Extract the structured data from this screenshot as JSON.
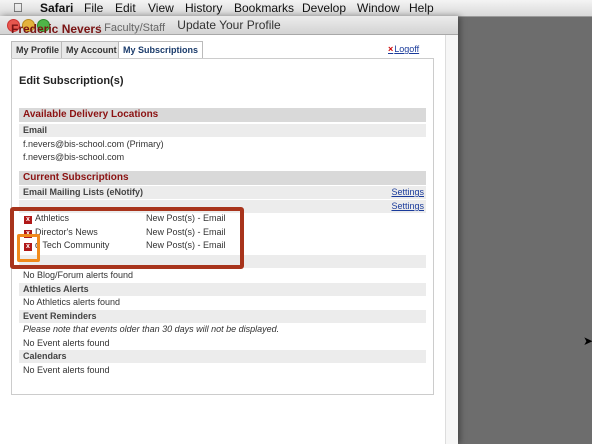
{
  "menubar": {
    "app": "Safari",
    "items": [
      "File",
      "Edit",
      "View",
      "History",
      "Bookmarks",
      "Develop",
      "Window",
      "Help"
    ]
  },
  "window": {
    "title": "Update Your Profile"
  },
  "profile": {
    "name": "Frederic Nevers",
    "role": ": Faculty/Staff"
  },
  "tabs": [
    "My Profile",
    "My Account",
    "My Subscriptions"
  ],
  "active_tab": "My Subscriptions",
  "logout": {
    "icon": "x-icon",
    "label": "Logoff"
  },
  "panel": {
    "title": "Edit Subscription(s)",
    "delivery": {
      "heading": "Available Delivery Locations",
      "email_label": "Email",
      "emails": [
        "f.nevers@bis-school.com  (Primary)",
        "f.nevers@bis-school.com"
      ]
    },
    "current": {
      "heading": "Current Subscriptions",
      "mailing_lists_label": "Email Mailing Lists (eNotify)",
      "settings_label": "Settings",
      "subscriptions": [
        {
          "name": "Athletics",
          "delivery": "New Post(s) - Email"
        },
        {
          "name": "Director's News",
          "delivery": "New Post(s) - Email"
        },
        {
          "name": "d Tech Community",
          "delivery": "New Post(s) - Email"
        }
      ]
    },
    "blog": {
      "message": "No Blog/Forum alerts found"
    },
    "athletics": {
      "label": "Athletics Alerts",
      "message": "No Athletics alerts found"
    },
    "events": {
      "label": "Event Reminders",
      "note": "Please note that events older than 30 days will not be displayed.",
      "message": "No Event alerts found"
    },
    "calendars": {
      "label": "Calendars",
      "message": "No Event alerts found"
    }
  },
  "colors": {
    "accent_dark_red": "#8b1111",
    "highlight_red": "#a8341c",
    "highlight_orange": "#f08a1c",
    "link_blue": "#1a3b9b"
  }
}
